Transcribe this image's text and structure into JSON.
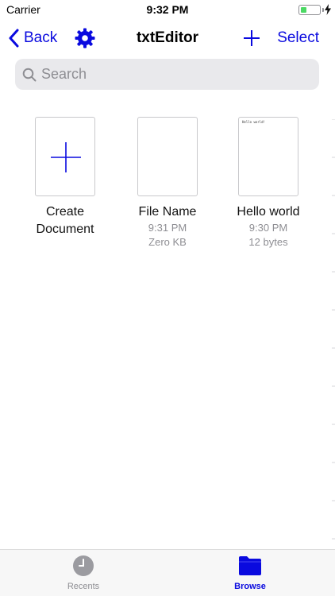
{
  "status_bar": {
    "carrier": "Carrier",
    "time": "9:32 PM",
    "battery_level": 0.3
  },
  "nav": {
    "back_label": "Back",
    "title": "txtEditor",
    "select_label": "Select",
    "icons": [
      "chevron-left-icon",
      "gear-icon",
      "plus-icon"
    ]
  },
  "search": {
    "placeholder": "Search"
  },
  "documents": [
    {
      "name": "Create Document",
      "icon": "plus-icon"
    },
    {
      "name": "File Name",
      "time": "9:31 PM",
      "size": "Zero KB"
    },
    {
      "name": "Hello world",
      "time": "9:30 PM",
      "size": "12 bytes",
      "preview": "Hello world!"
    }
  ],
  "tabs": [
    {
      "label": "Recents",
      "icon": "clock-icon",
      "selected": false
    },
    {
      "label": "Browse",
      "icon": "folder-icon",
      "selected": true
    }
  ],
  "colors": {
    "accent": "#0a0adf",
    "battery": "#4cd964",
    "secondary_text": "#8e8e93"
  }
}
